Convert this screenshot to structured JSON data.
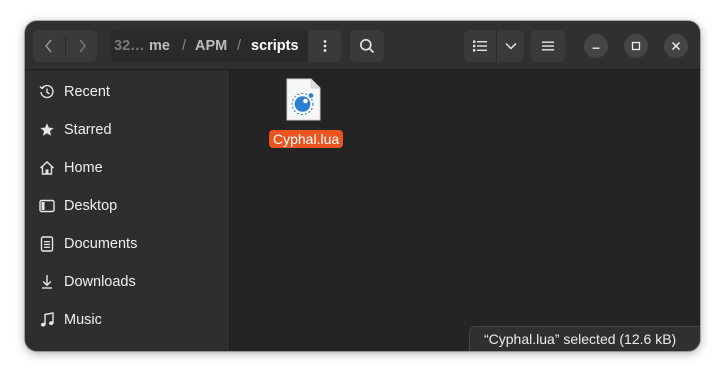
{
  "window": {
    "title": "scripts"
  },
  "header": {
    "back_icon": "chevron-left-icon",
    "forward_icon": "chevron-right-icon",
    "breadcrumbs": [
      {
        "label": "32…"
      },
      {
        "label": "me"
      },
      {
        "label": "APM"
      },
      {
        "label": "scripts"
      }
    ],
    "separator": "/",
    "path_menu_icon": "vertical-dots-icon",
    "search_icon": "search-icon",
    "view_icon": "list-view-icon",
    "view_dropdown_icon": "chevron-down-icon",
    "main_menu_icon": "hamburger-menu-icon"
  },
  "window_controls": {
    "minimize_icon": "minimize-icon",
    "maximize_icon": "maximize-icon",
    "close_icon": "close-icon"
  },
  "sidebar": {
    "items": [
      {
        "label": "Recent",
        "icon": "clock-icon"
      },
      {
        "label": "Starred",
        "icon": "star-icon"
      },
      {
        "label": "Home",
        "icon": "home-icon"
      },
      {
        "label": "Desktop",
        "icon": "desktop-icon"
      },
      {
        "label": "Documents",
        "icon": "document-icon"
      },
      {
        "label": "Downloads",
        "icon": "download-icon"
      },
      {
        "label": "Music",
        "icon": "music-icon"
      }
    ]
  },
  "files": [
    {
      "name": "Cyphal.lua",
      "icon": "lua-file-icon",
      "selected": true
    }
  ],
  "status_bar": {
    "text": "“Cyphal.lua” selected  (12.6 kB)"
  },
  "colors": {
    "accent": "#e95420",
    "window_bg": "#242424",
    "sidebar_bg": "#2e2e2e",
    "header_bg": "#303030"
  }
}
